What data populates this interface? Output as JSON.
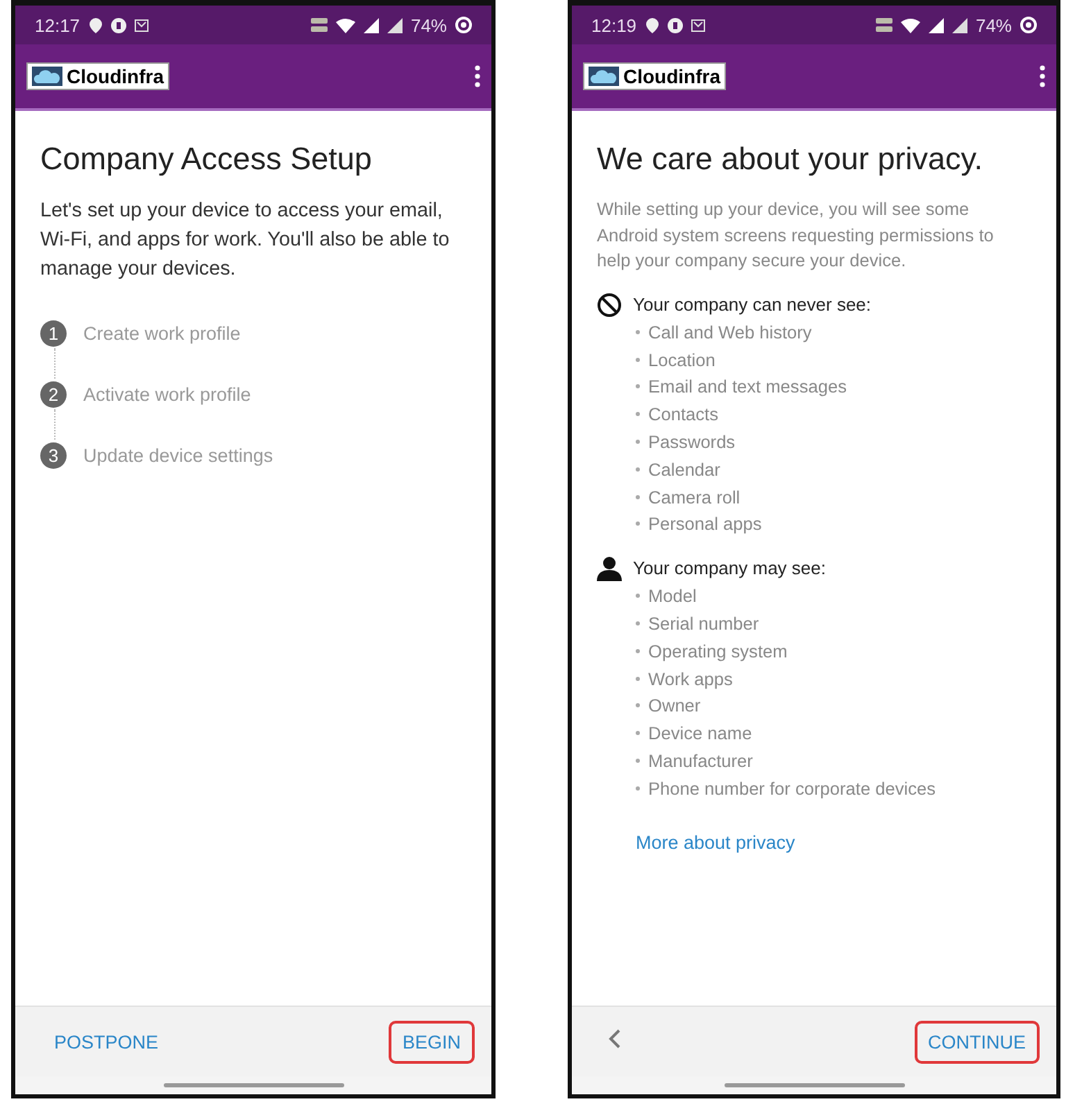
{
  "screens": [
    {
      "kind": "setup",
      "status_bar": {
        "time": "12:17",
        "battery": "74%"
      },
      "app_bar": {
        "logo": "Cloudinfra"
      },
      "title": "Company Access Setup",
      "intro": "Let's set up your device to access your email, Wi-Fi, and apps for work. You'll also be able to manage your devices.",
      "steps": [
        {
          "number": "1",
          "label": "Create work profile"
        },
        {
          "number": "2",
          "label": "Activate work profile"
        },
        {
          "number": "3",
          "label": "Update device settings"
        }
      ],
      "footer": {
        "back": false,
        "buttons": [
          {
            "label": "POSTPONE",
            "highlighted": false
          },
          {
            "label": "BEGIN",
            "highlighted": true
          }
        ]
      }
    },
    {
      "kind": "privacy",
      "status_bar": {
        "time": "12:19",
        "battery": "74%"
      },
      "app_bar": {
        "logo": "Cloudinfra"
      },
      "title": "We care about your privacy.",
      "intro": "While setting up your device, you will see some Android system screens requesting permissions to help your company secure your device.",
      "sections": [
        {
          "kind": "never",
          "heading": "Your company can never see:",
          "items": [
            "Call and Web history",
            "Location",
            "Email and text messages",
            "Contacts",
            "Passwords",
            "Calendar",
            "Camera roll",
            "Personal apps"
          ]
        },
        {
          "kind": "may",
          "heading": "Your company may see:",
          "items": [
            "Model",
            "Serial number",
            "Operating system",
            "Work apps",
            "Owner",
            "Device name",
            "Manufacturer",
            "Phone number for corporate devices"
          ]
        }
      ],
      "link": "More about privacy",
      "footer": {
        "back": true,
        "buttons": [
          {
            "label": "CONTINUE",
            "highlighted": true
          }
        ]
      }
    }
  ]
}
